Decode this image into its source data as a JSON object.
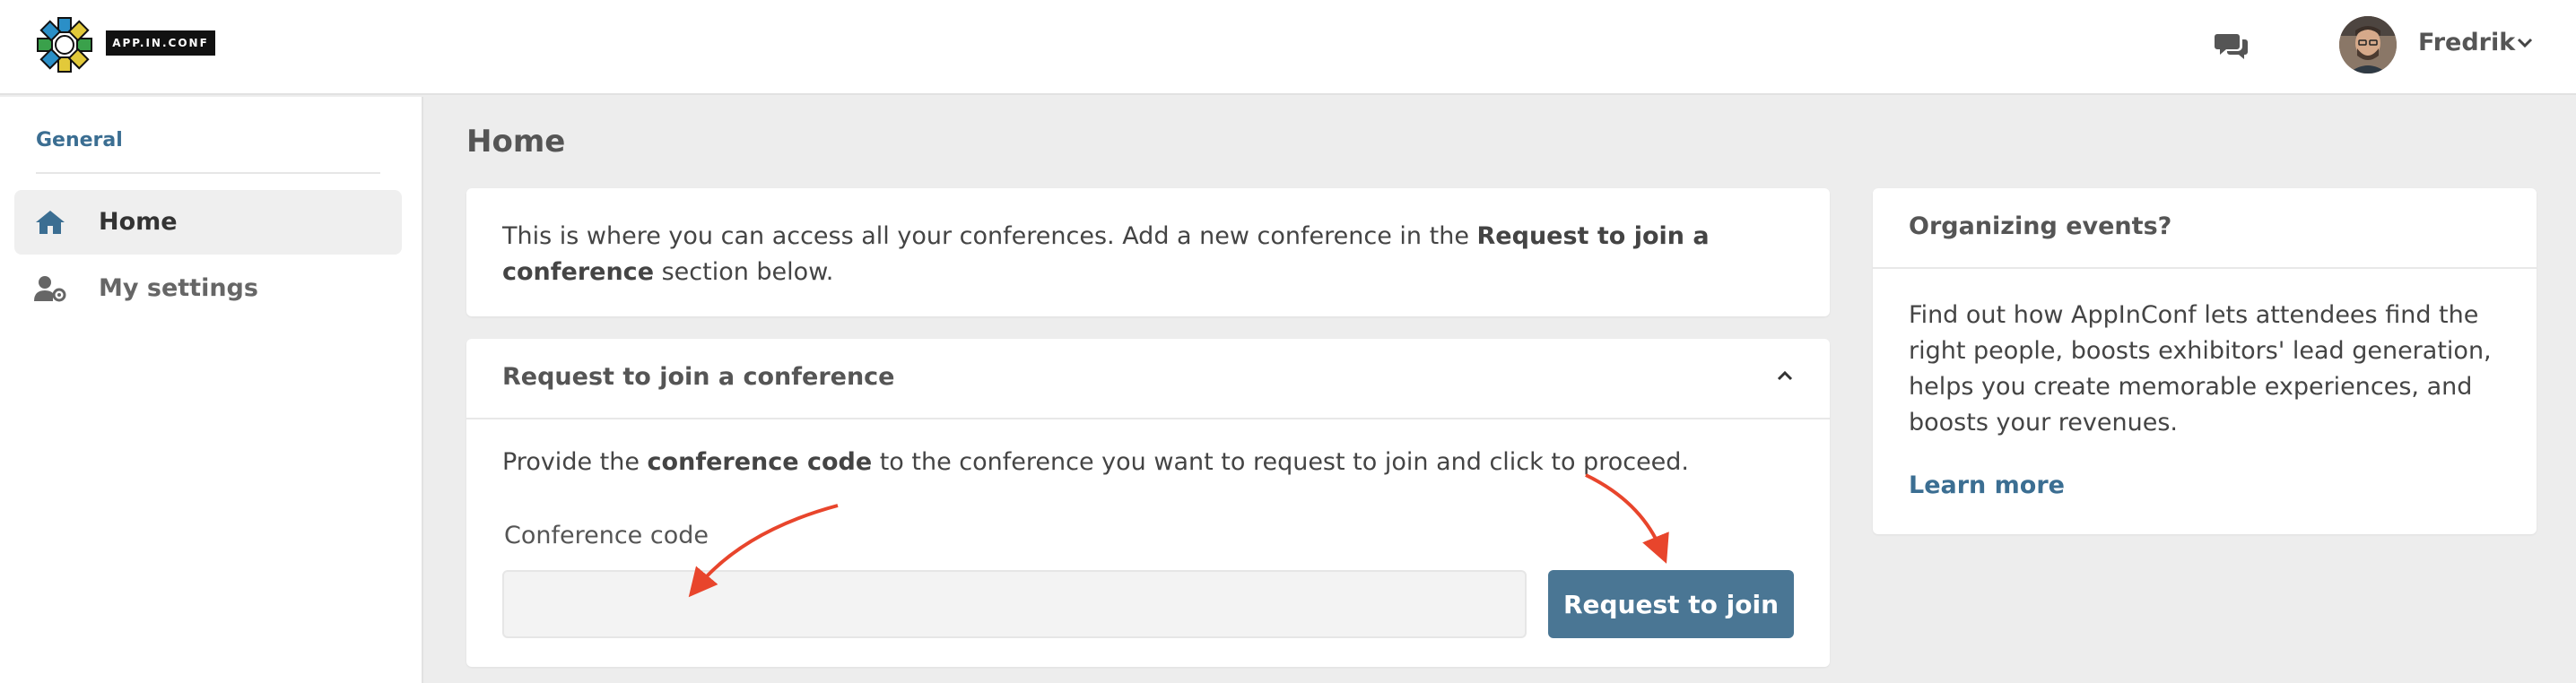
{
  "header": {
    "logo_text": "APP.IN.CONF",
    "user_name": "Fredrik"
  },
  "sidebar": {
    "section_label": "General",
    "items": [
      {
        "label": "Home",
        "icon": "home-icon",
        "active": true
      },
      {
        "label": "My settings",
        "icon": "user-settings-icon",
        "active": false
      }
    ]
  },
  "main": {
    "title": "Home",
    "intro": {
      "text_before": "This is where you can access all your conferences. Add a new conference in the ",
      "text_bold": "Request to join a conference",
      "text_after": " section below."
    },
    "join": {
      "title": "Request to join a conference",
      "desc_before": "Provide the ",
      "desc_bold": "conference code",
      "desc_after": " to the conference you want to request to join and click to proceed.",
      "field_label": "Conference code",
      "field_value": "",
      "button_label": "Request to join"
    },
    "organize": {
      "title": "Organizing events?",
      "desc": "Find out how AppInConf lets attendees find the right people, boosts exhibitors' lead generation, helps you create memorable experiences, and boosts your revenues.",
      "link_label": "Learn more"
    }
  },
  "colors": {
    "accent": "#3b6e92",
    "button": "#4a7694",
    "annotation_arrow": "#e8452c"
  }
}
